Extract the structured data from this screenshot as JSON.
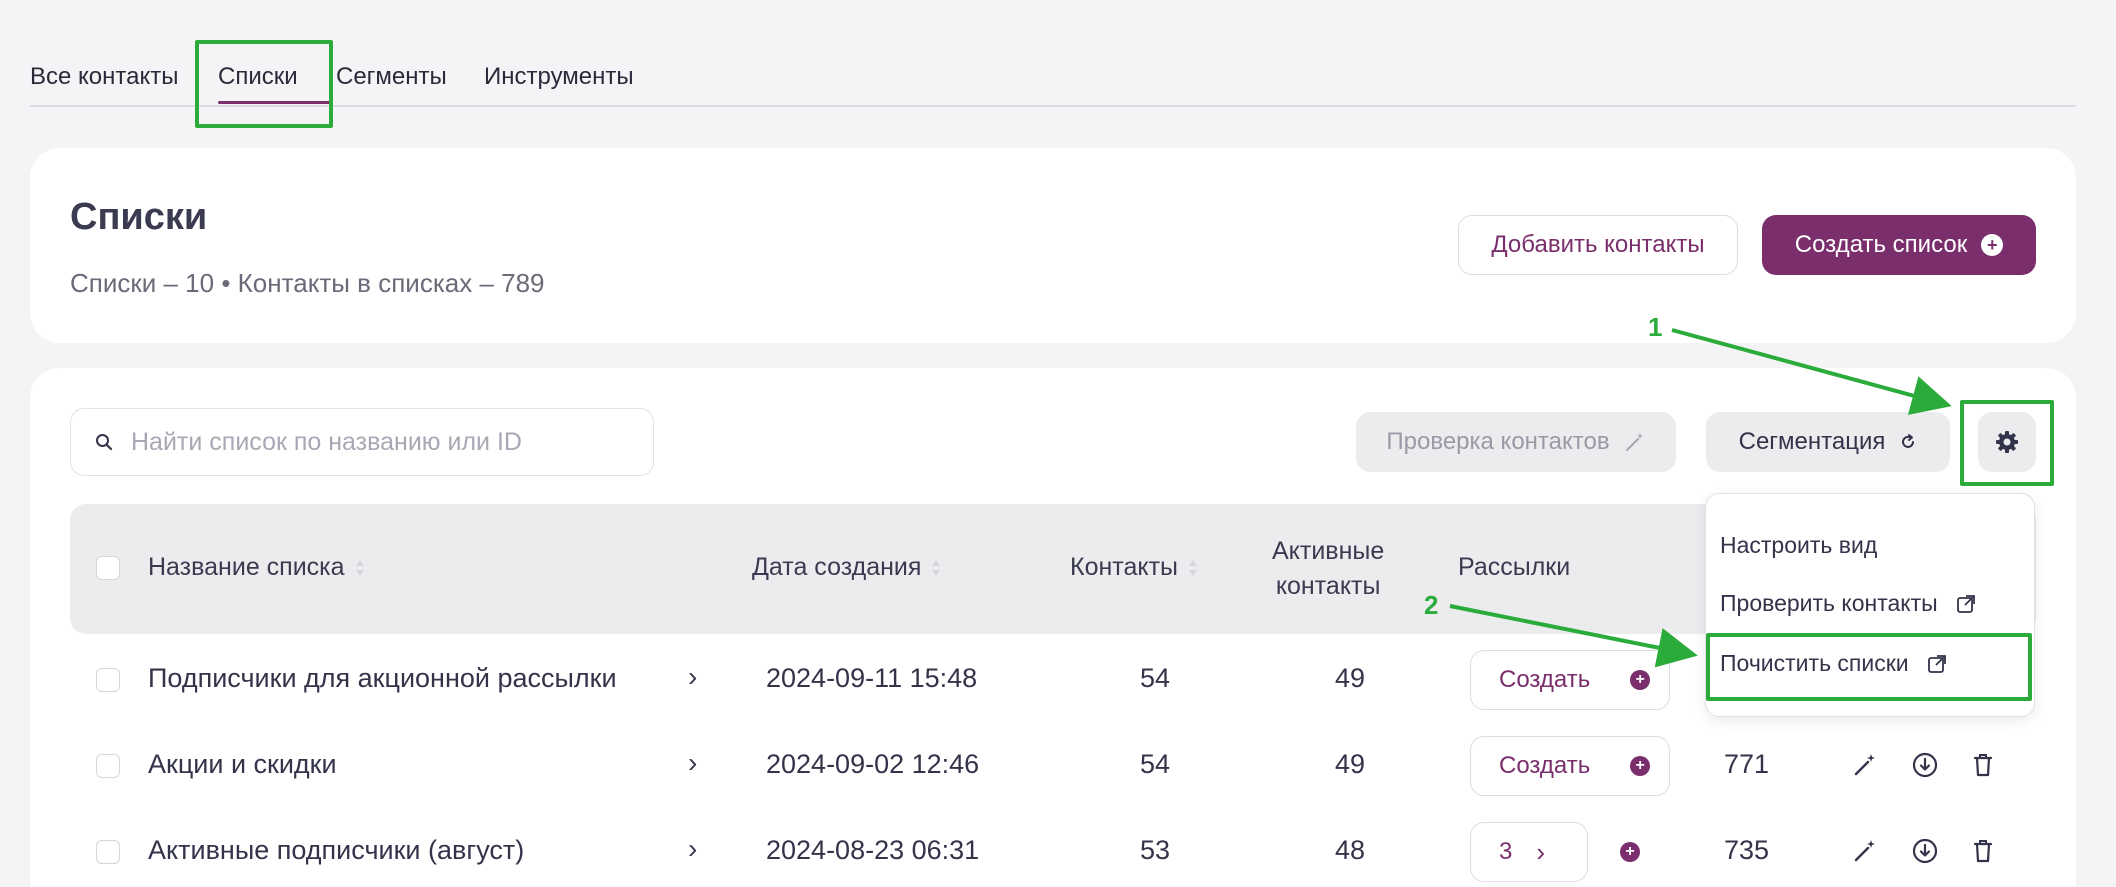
{
  "tabs": [
    "Все контакты",
    "Списки",
    "Сегменты",
    "Инструменты"
  ],
  "header": {
    "title": "Списки",
    "subtitle": "Списки – 10 • Контакты в списках – 789",
    "add_contacts": "Добавить контакты",
    "create_list": "Создать список"
  },
  "toolbar": {
    "search_placeholder": "Найти список по названию или ID",
    "check_contacts": "Проверка контактов",
    "segmentation": "Сегментация"
  },
  "table": {
    "headers": {
      "name": "Название списка",
      "date": "Дата создания",
      "contacts": "Контакты",
      "active_1": "Активные",
      "active_2": "контакты",
      "mailings": "Рассылки"
    },
    "rows": [
      {
        "name": "Подписчики для акционной рассылки",
        "date": "2024-09-11 15:48",
        "contacts": "54",
        "active": "49",
        "mailing": "Создать",
        "id": ""
      },
      {
        "name": "Акции и скидки",
        "date": "2024-09-02 12:46",
        "contacts": "54",
        "active": "49",
        "mailing": "Создать",
        "id": "771"
      },
      {
        "name": "Активные подписчики (август)",
        "date": "2024-08-23 06:31",
        "contacts": "53",
        "active": "48",
        "mailing": "3",
        "id": "735"
      }
    ]
  },
  "dropdown": {
    "items": [
      "Настроить вид",
      "Проверить контакты",
      "Почистить списки"
    ]
  },
  "annotations": [
    "1",
    "2"
  ],
  "colors": {
    "accent": "#7a2e6b",
    "highlight": "#2aab3a"
  }
}
